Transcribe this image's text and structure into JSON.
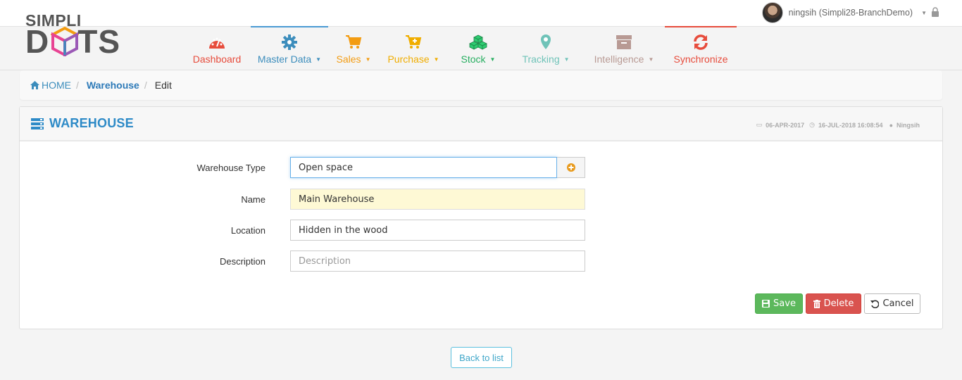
{
  "user": {
    "name": "ningsih (Simpli28-BranchDemo)"
  },
  "logo": {
    "top": "SIMPLI",
    "bottom": "DOTS"
  },
  "nav": {
    "items": [
      {
        "label": "Dashboard",
        "color": "#e74c3c",
        "icon": "dashboard-gauge-icon"
      },
      {
        "label": "Master Data",
        "color": "#3c8dbc",
        "icon": "gear-icon"
      },
      {
        "label": "Sales",
        "color": "#f39c12",
        "icon": "cart-icon"
      },
      {
        "label": "Purchase",
        "color": "#f0ad00",
        "icon": "cart-plus-icon"
      },
      {
        "label": "Stock",
        "color": "#27ae60",
        "icon": "cubes-icon"
      },
      {
        "label": "Tracking",
        "color": "#6fc3b8",
        "icon": "map-marker-icon"
      },
      {
        "label": "Intelligence",
        "color": "#b89a94",
        "icon": "archive-icon"
      },
      {
        "label": "Synchronize",
        "color": "#e74c3c",
        "icon": "refresh-icon"
      }
    ]
  },
  "breadcrumb": {
    "home": "HOME",
    "section": "Warehouse",
    "current": "Edit"
  },
  "panel": {
    "title": "WAREHOUSE",
    "created": "06-APR-2017",
    "modified": "16-JUL-2018 16:08:54",
    "user": "Ningsih"
  },
  "form": {
    "type_label": "Warehouse Type",
    "type_value": "Open space",
    "name_label": "Name",
    "name_value": "Main Warehouse",
    "location_label": "Location",
    "location_value": "Hidden in the wood",
    "description_label": "Description",
    "description_placeholder": "Description"
  },
  "actions": {
    "save": "Save",
    "delete": "Delete",
    "cancel": "Cancel",
    "back": "Back to list"
  }
}
